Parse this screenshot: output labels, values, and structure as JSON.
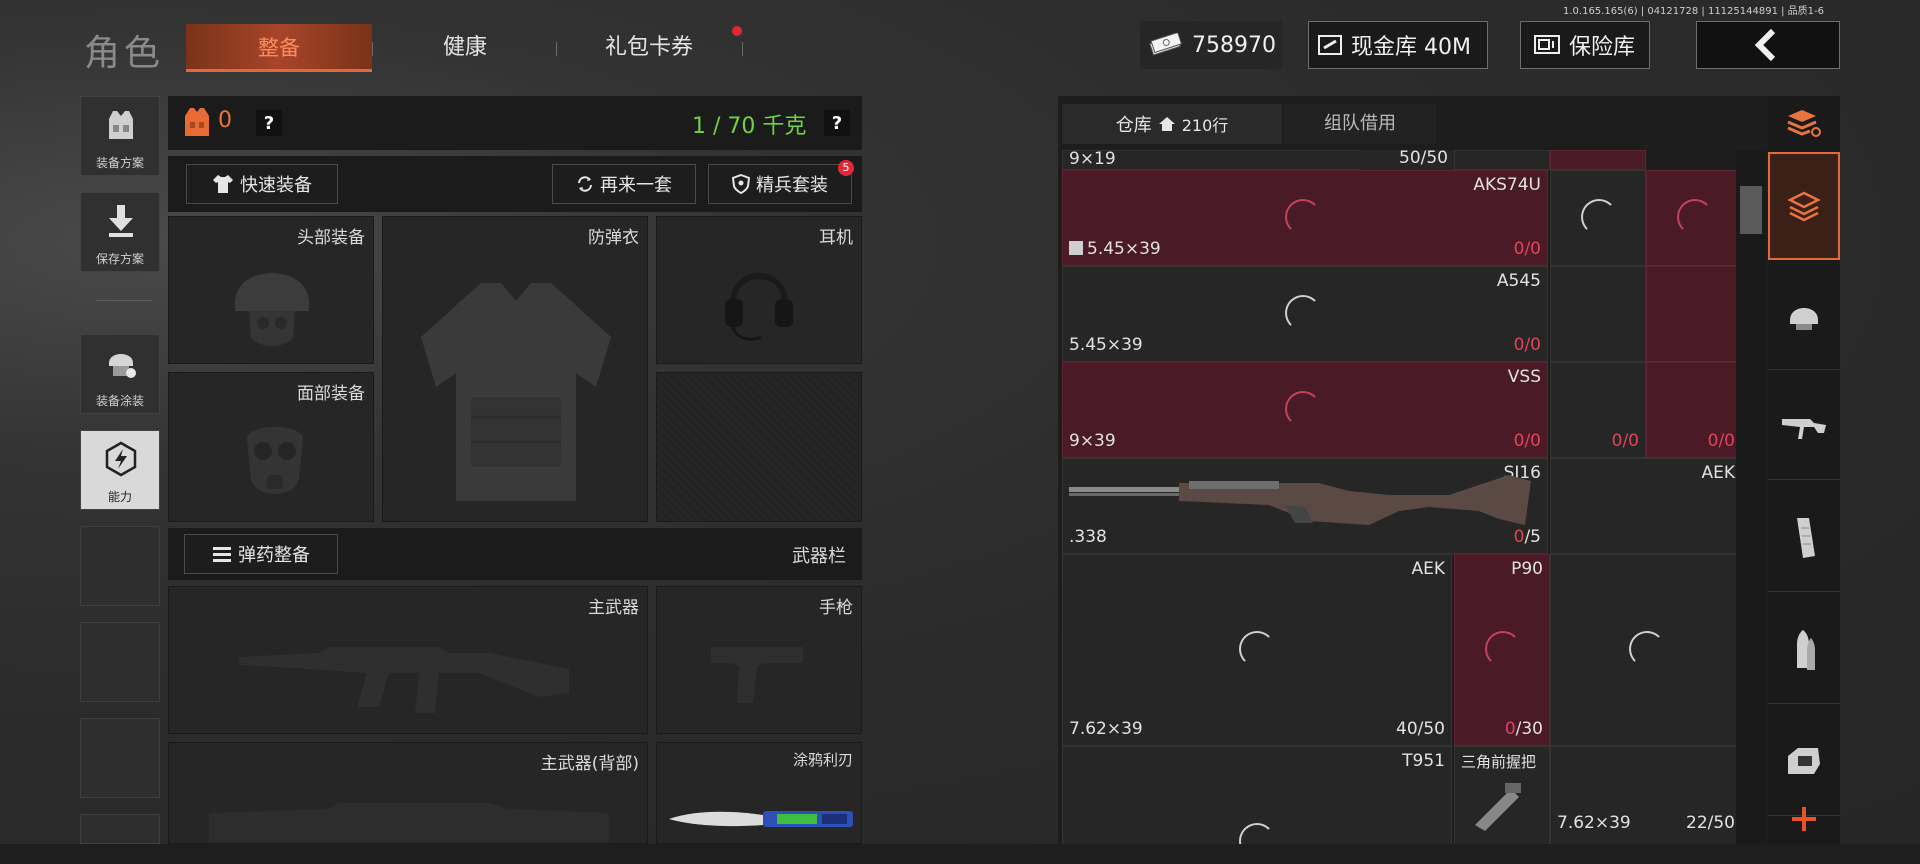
{
  "version": "1.0.165.165(6) | 04121728 | 11125144891 | 品质1-6",
  "header": {
    "title": "角色",
    "tabs": [
      {
        "label": "整备",
        "active": true
      },
      {
        "label": "健康"
      },
      {
        "label": "礼包卡券",
        "badge": true
      }
    ],
    "money": "758970",
    "cash_vault": "现金库 40M",
    "insurance": "保险库"
  },
  "left_nav": [
    {
      "label": "装备方案",
      "icon": "vest-icon"
    },
    {
      "label": "保存方案",
      "icon": "download-icon"
    },
    {
      "label": "装备涂装",
      "icon": "helmet-paint-icon"
    },
    {
      "label": "能力",
      "icon": "ability-icon",
      "active": true
    }
  ],
  "loadout": {
    "armor_count": "0",
    "weight": "1 / 70 千克",
    "help": "?",
    "quick_equip": "快速装备",
    "again": "再来一套",
    "elite_set": "精兵套装",
    "elite_badge": "5",
    "slots": {
      "head": "头部装备",
      "vest": "防弹衣",
      "headset": "耳机",
      "face": "面部装备"
    },
    "ammo_btn": "弹药整备",
    "weapon_bar": "武器栏",
    "weapon_slots": {
      "primary": "主武器",
      "pistol": "手枪",
      "primary_back": "主武器(背部)",
      "knife": "涂鸦利刃"
    }
  },
  "warehouse": {
    "tab_storage": "仓库",
    "rows": "210行",
    "tab_team": "组队借用",
    "items": {
      "r0_cal": "9×19",
      "r0_count": "50/50",
      "aks_name": "AKS74U",
      "aks_cal": "5.45×39",
      "aks_count_a": "0",
      "aks_count_b": "/0",
      "a545_name": "A545",
      "a545_cal": "5.45×39",
      "a545_count_a": "0",
      "a545_count_b": "/0",
      "vss_name": "VSS",
      "vss_cal": "9×39",
      "vss_count_a": "0",
      "vss_count_b": "/0",
      "vss_c2a": "0",
      "vss_c2b": "/0",
      "vss_c3a": "0",
      "vss_c3b": "/0",
      "sj16_name": "SJ16",
      "sj16_cal": ".338",
      "sj16_count_a": "0",
      "sj16_count_b": "/5",
      "aek_right": "AEK",
      "aek_name": "AEK",
      "aek_cal": "7.62×39",
      "aek_count": "40/50",
      "p90_name": "P90",
      "p90_count_a": "0",
      "p90_count_b": "/30",
      "t951_name": "T951",
      "grip_name": "三角前握把",
      "r7_cal": "7.62×39",
      "r7_count": "22/50"
    }
  },
  "colors": {
    "accent": "#e06a3a",
    "weight_green": "#6fd23f",
    "locked_red": "#4a1b26",
    "count_pink": "#e0435f"
  }
}
